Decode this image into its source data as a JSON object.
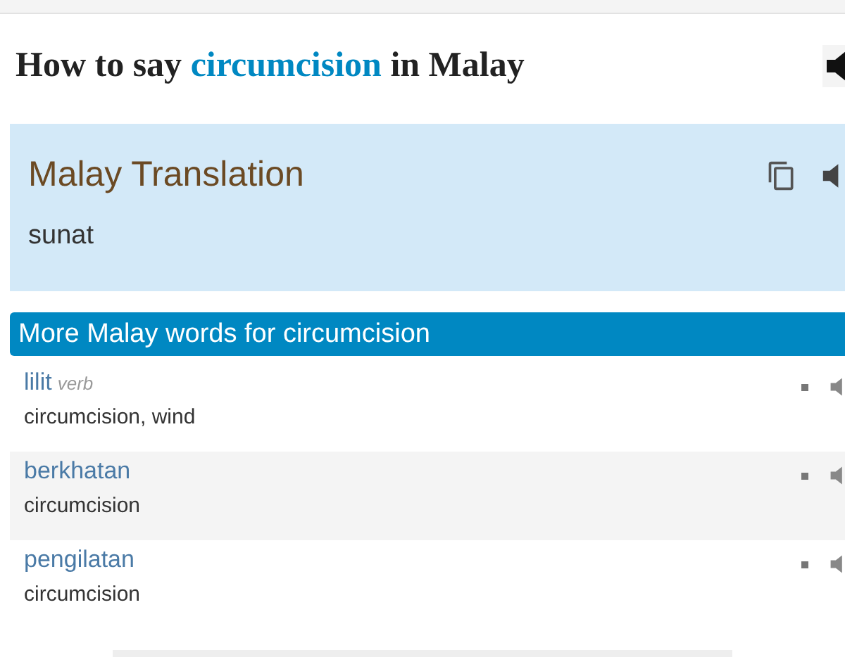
{
  "heading": {
    "before": "How to say",
    "word": "circumcision",
    "after": "in Malay"
  },
  "translation": {
    "title": "Malay Translation",
    "text": "sunat"
  },
  "more": {
    "title": "More Malay words for circumcision",
    "rows": [
      {
        "word": "lilit",
        "pos": "verb",
        "meaning": "circumcision, wind"
      },
      {
        "word": "berkhatan",
        "meaning": "circumcision"
      },
      {
        "word": "pengilatan",
        "meaning": "circumcision"
      }
    ]
  }
}
